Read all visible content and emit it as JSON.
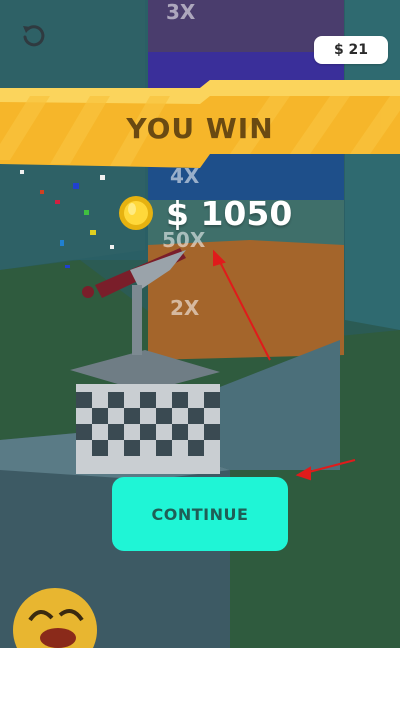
{
  "header": {
    "money": "$ 21"
  },
  "banner": {
    "title": "YOU WIN"
  },
  "reward": {
    "amount": "$ 1050"
  },
  "continue_button": {
    "label": "CONTINUE"
  },
  "multipliers": [
    "3X",
    "4X",
    "50X",
    "2X"
  ],
  "icons": {
    "restart": "restart-icon",
    "coin": "coin-icon",
    "emoji": "laughing-emoji-icon"
  },
  "colors": {
    "banner": "#f6b62a",
    "button": "#1ff5d6",
    "arrow": "#e01b1b"
  }
}
